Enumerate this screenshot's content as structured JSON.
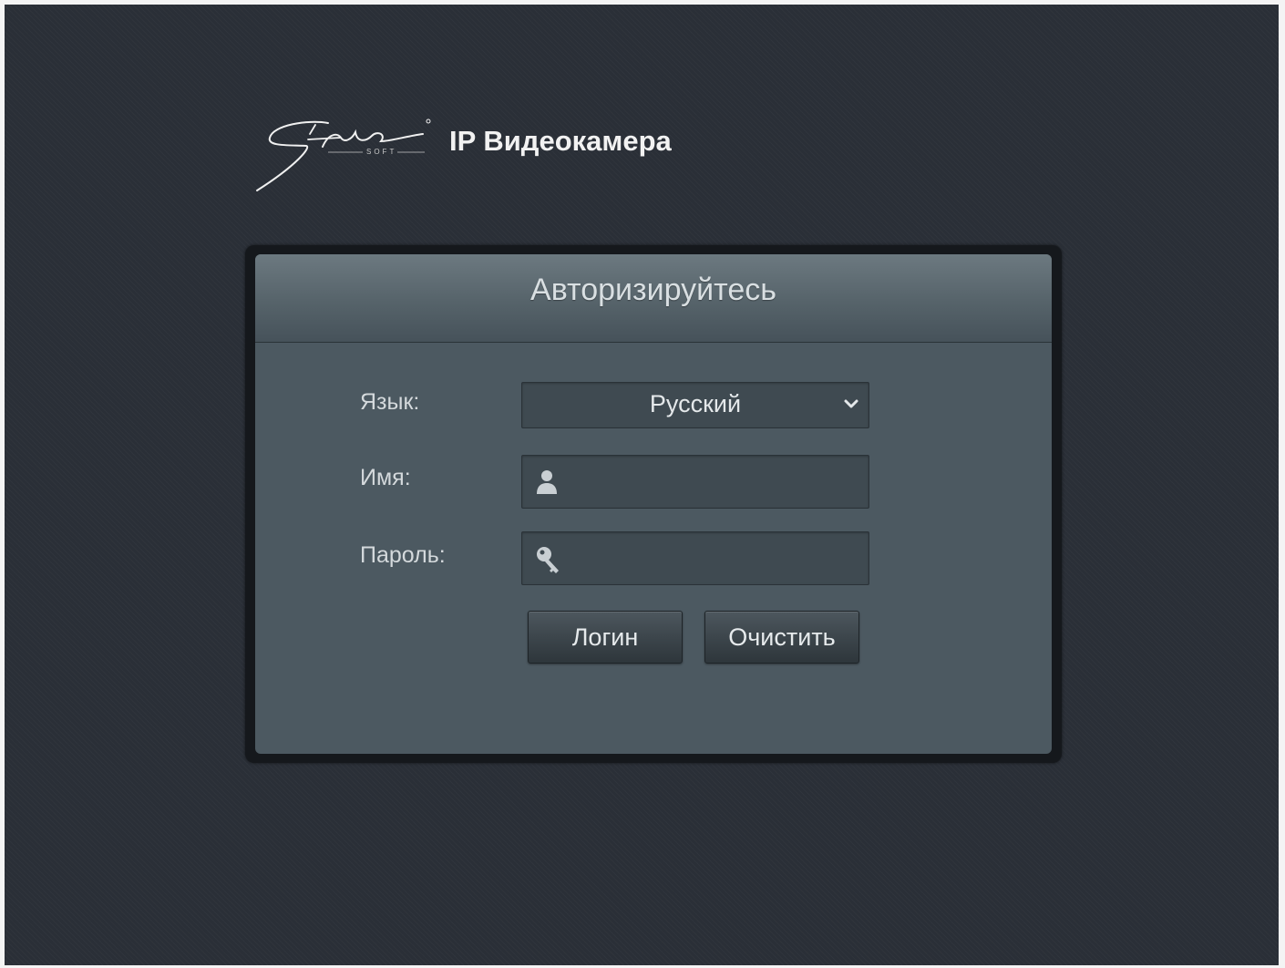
{
  "brand": {
    "title": "IP Видеокамера",
    "logo_text": "Stic SOFT"
  },
  "login": {
    "heading": "Авторизируйтесь",
    "language_label": "Язык:",
    "language_value": "Русский",
    "username_label": "Имя:",
    "username_value": "",
    "password_label": "Пароль:",
    "password_value": "",
    "login_button": "Логин",
    "clear_button": "Очистить"
  },
  "icons": {
    "language_select": "chevron-down-icon",
    "username": "user-icon",
    "password": "key-icon"
  },
  "colors": {
    "background": "#2a2f37",
    "panel": "#4c5961",
    "header": "#5f6c73",
    "field": "#3f4a51",
    "text": "#e4e8ea"
  }
}
